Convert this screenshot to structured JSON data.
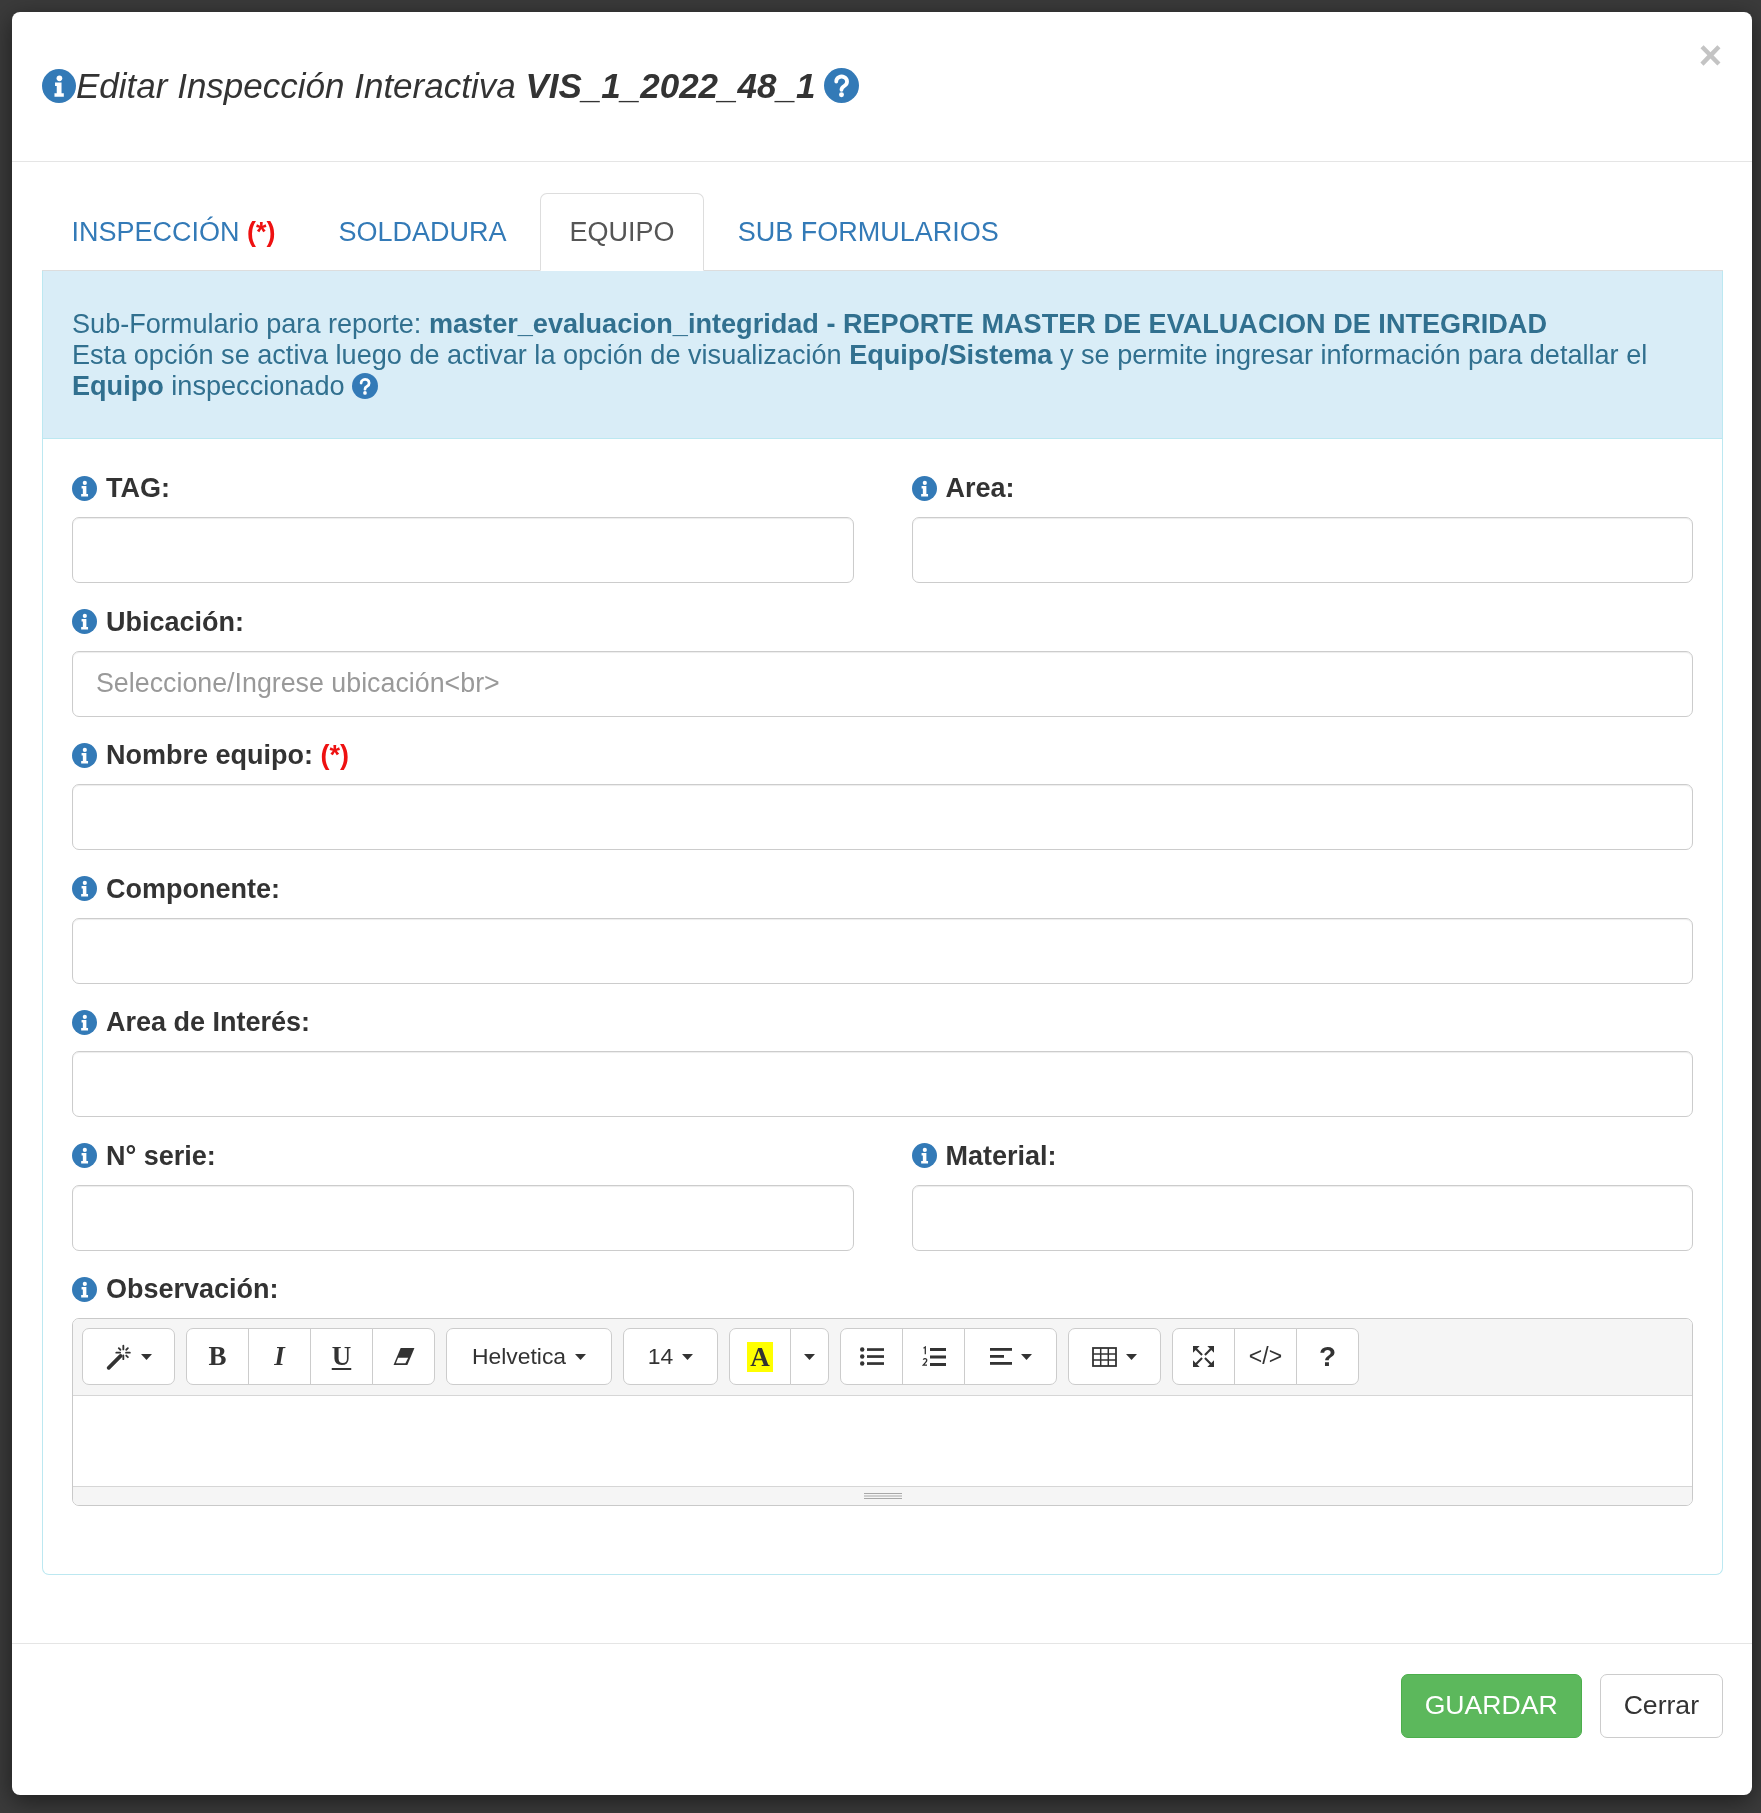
{
  "dialog": {
    "title": "Editar Inspección Interactiva **VIS_1_2022_48_1**",
    "close": "×"
  },
  "tabs": [
    {
      "label": "INSPECCIÓN",
      "required_mark": "(*)",
      "selected": false
    },
    {
      "label": "SOLDADURA",
      "selected": false
    },
    {
      "label": "EQUIPO",
      "selected": true
    },
    {
      "label": "SUB FORMULARIOS",
      "selected": false
    }
  ],
  "info_panel": {
    "lines": [
      "Sub-Formulario para reporte: **master_evaluacion_integridad - REPORTE MASTER DE EVALUACION DE INTEGRIDAD**",
      "Esta opción se activa luego de activar la opción de visualización **Equipo/Sistema** y se permite ingresar información para detallar el",
      "**Equipo** inspeccionado"
    ]
  },
  "form": {
    "rows": [
      [
        {
          "label": "TAG:",
          "kind": "text"
        },
        {
          "label": "Area:",
          "kind": "text"
        }
      ],
      [
        {
          "label": "Ubicación:",
          "kind": "text",
          "placeholder": "Seleccione/Ingrese ubicación<br>"
        }
      ],
      [
        {
          "label": "Nombre equipo:",
          "required_mark": "(*)",
          "kind": "text"
        }
      ],
      [
        {
          "label": "Componente:",
          "kind": "text"
        }
      ],
      [
        {
          "label": "Area de Interés:",
          "kind": "text"
        }
      ],
      [
        {
          "label": "N° serie:",
          "kind": "text"
        },
        {
          "label": "Material:",
          "kind": "text"
        }
      ],
      [
        {
          "label": "Observación:",
          "kind": "editor",
          "toolbar": [
            [
              {
                "kind": "style",
                "dropdown": true
              }
            ],
            [
              {
                "kind": "bold",
                "label": "B"
              },
              {
                "kind": "italic",
                "label": "I"
              },
              {
                "kind": "underline",
                "label": "U"
              },
              {
                "kind": "clear"
              }
            ],
            [
              {
                "kind": "font",
                "label": "Helvetica",
                "dropdown": true
              }
            ],
            [
              {
                "kind": "size",
                "label": "14",
                "dropdown": true
              }
            ],
            [
              {
                "kind": "color",
                "label": "A"
              },
              {
                "kind": "color_menu",
                "dropdown": true
              }
            ],
            [
              {
                "kind": "bullets"
              },
              {
                "kind": "numbers"
              },
              {
                "kind": "align",
                "dropdown": true
              }
            ],
            [
              {
                "kind": "table",
                "dropdown": true
              }
            ],
            [
              {
                "kind": "fullscreen"
              },
              {
                "kind": "codeview",
                "label": "</>"
              },
              {
                "kind": "help",
                "label": "?"
              }
            ]
          ]
        }
      ]
    ]
  },
  "footer": {
    "buttons": [
      {
        "label": "GUARDAR",
        "kind": "primary"
      },
      {
        "label": "Cerrar",
        "kind": "default"
      }
    ]
  }
}
